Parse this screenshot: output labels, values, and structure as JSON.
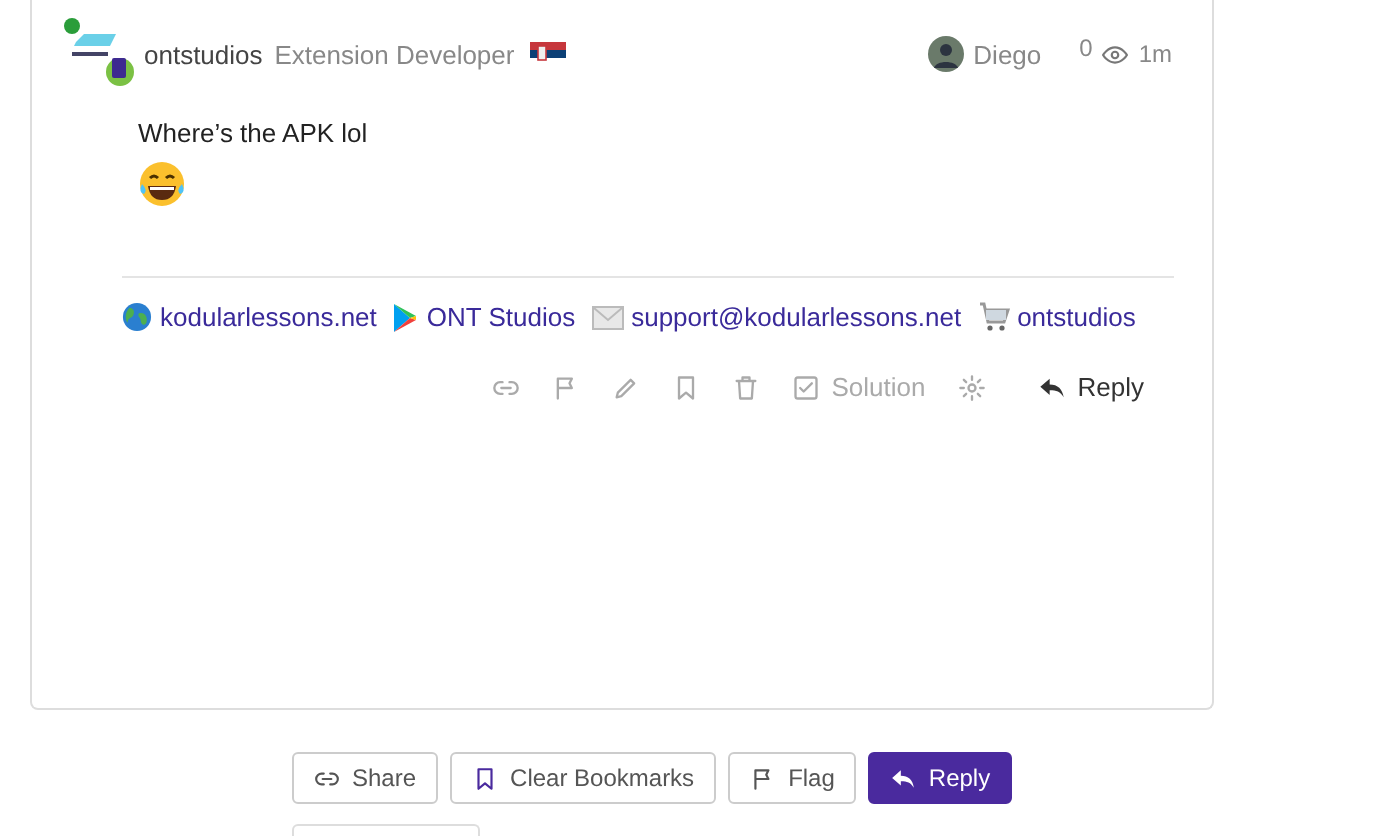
{
  "post": {
    "author": {
      "username": "ontstudios",
      "title": "Extension Developer",
      "online": true
    },
    "reply_to": {
      "username": "Diego"
    },
    "reads": "0",
    "age": "1m",
    "body": "Where’s the APK lol",
    "links": [
      {
        "kind": "globe",
        "label": "kodularlessons.net"
      },
      {
        "kind": "play",
        "label": "ONT Studios"
      },
      {
        "kind": "mail",
        "label": "support@kodularlessons.net"
      },
      {
        "kind": "cart",
        "label": "ontstudios"
      }
    ],
    "actions": {
      "solution": "Solution",
      "reply": "Reply"
    }
  },
  "footer_buttons": [
    {
      "kind": "share",
      "label": "Share",
      "primary": false
    },
    {
      "kind": "bookmark",
      "label": "Clear Bookmarks",
      "primary": false
    },
    {
      "kind": "flag",
      "label": "Flag",
      "primary": false
    },
    {
      "kind": "reply",
      "label": "Reply",
      "primary": true
    }
  ]
}
